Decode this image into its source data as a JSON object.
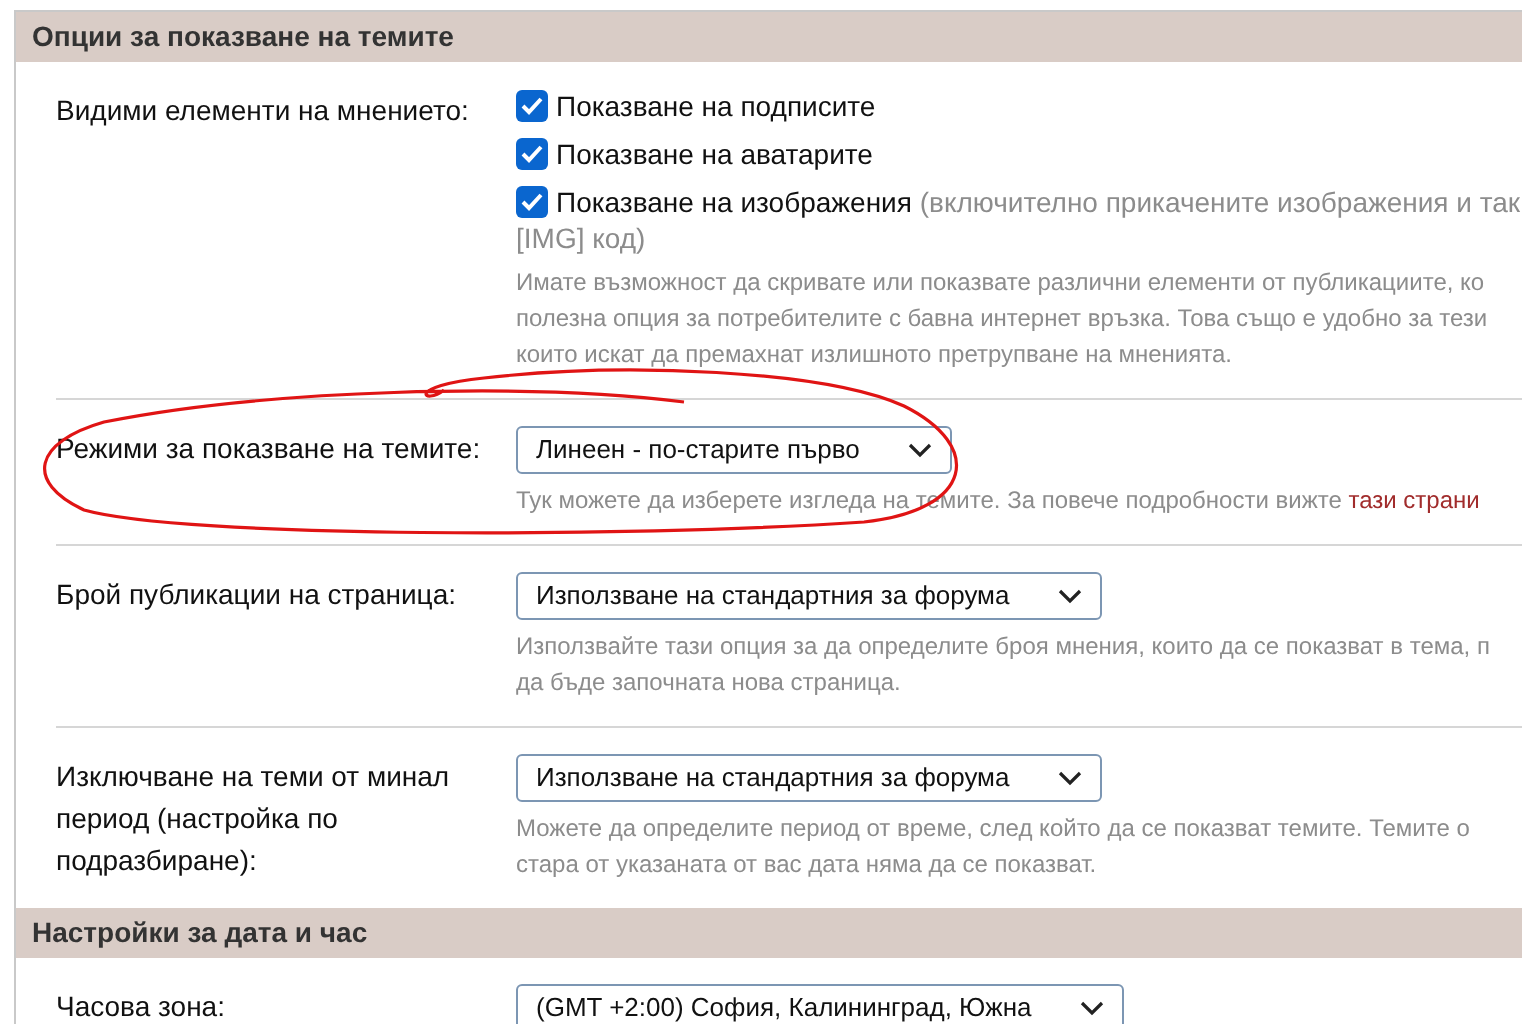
{
  "sections": [
    {
      "title": "Опции за показване на темите",
      "rows": [
        {
          "kind": "checkboxes",
          "label": "Видими елементи на мнението:",
          "options": [
            {
              "label": "Показване на подписите",
              "checked": true
            },
            {
              "label": "Показване на аватарите",
              "checked": true
            },
            {
              "label": "Показване на изображения",
              "checked": true,
              "note_lines": [
                "(включително прикачените изображения и так",
                "[IMG] код)"
              ]
            }
          ],
          "help_lines": [
            "Имате възможност да скривате или показвате различни елементи от публикациите, ко",
            "полезна опция за потребителите с бавна интернет връзка. Това също е удобно за тези",
            "които искат да премахнат излишното претрупване на мненията."
          ]
        },
        {
          "kind": "select",
          "label": "Режими за показване на темите:",
          "value": "Линеен - по-старите първо",
          "help_lines": [
            "Тук можете да изберете изгледа на темите. За повече подробности вижте"
          ],
          "help_link": "тази страни"
        },
        {
          "kind": "select",
          "label": "Брой публикации на страница:",
          "value": "Използване на стандартния за форума",
          "help_lines": [
            "Използвайте тази опция за да определите броя мнения, които да се показват в тема, п",
            "да бъде започната нова страница."
          ]
        },
        {
          "kind": "select",
          "label": "Изключване на теми от минал период (настройка по подразбиране):",
          "value": "Използване на стандартния за форума",
          "help_lines": [
            "Можете да определите период от време, след който да се показват темите. Темите о",
            "стара от указаната от вас дата няма да се показват."
          ]
        }
      ]
    },
    {
      "title": "Настройки за дата и час",
      "rows": [
        {
          "kind": "select",
          "label": "Часова зона:",
          "value": "(GMT +2:00) София, Калининград, Южна"
        }
      ]
    }
  ]
}
